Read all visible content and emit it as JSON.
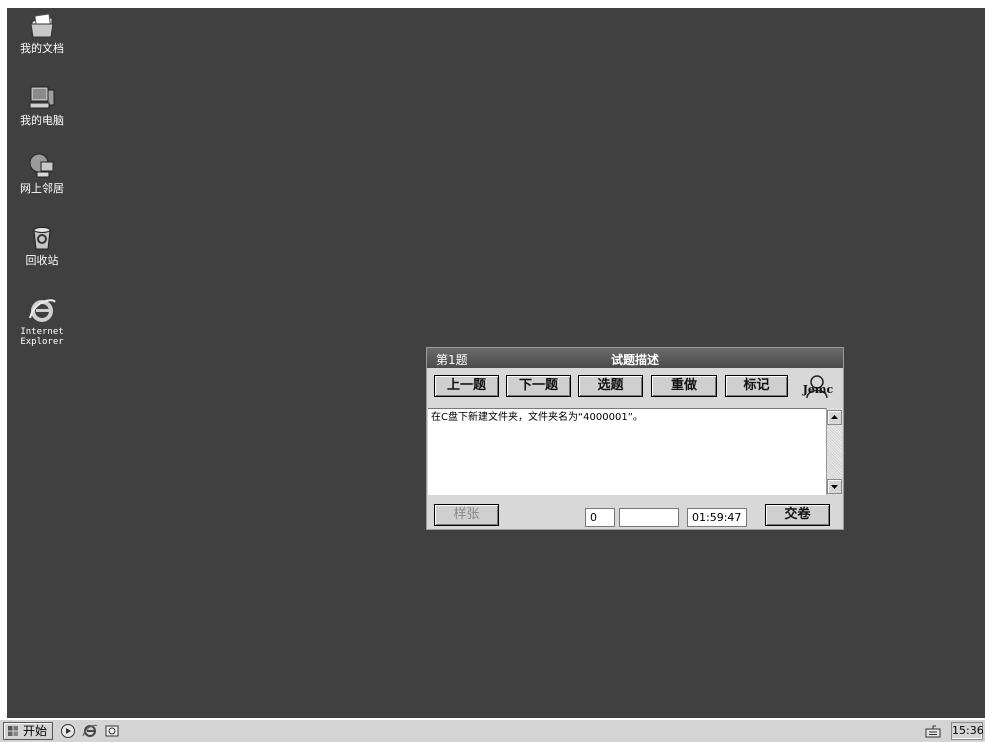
{
  "desktop": {
    "icons": [
      {
        "label": "我的文档",
        "icon": "my-documents-icon"
      },
      {
        "label": "我的电脑",
        "icon": "my-computer-icon"
      },
      {
        "label": "网上邻居",
        "icon": "network-places-icon"
      },
      {
        "label": "回收站",
        "icon": "recycle-bin-icon"
      },
      {
        "label": "Internet\nExplorer",
        "icon": "internet-explorer-icon"
      }
    ]
  },
  "exam_window": {
    "question_number": "第1题",
    "title": "试题描述",
    "buttons": {
      "prev": "上一题",
      "next": "下一题",
      "select": "选题",
      "redo": "重做",
      "mark": "标记"
    },
    "logo_text": "Jemc",
    "question_text": "在C盘下新建文件夹，文件夹名为“4000001”。",
    "sample_button": "样张",
    "counter": "0",
    "blank_field": "",
    "timer": "01:59:47",
    "submit_button": "交卷"
  },
  "taskbar": {
    "start_label": "开始",
    "quick_launch": [
      "media-player-icon",
      "ie-icon",
      "outlook-express-icon"
    ],
    "tray_icon": "keyboard-icon",
    "clock": "15:36"
  }
}
